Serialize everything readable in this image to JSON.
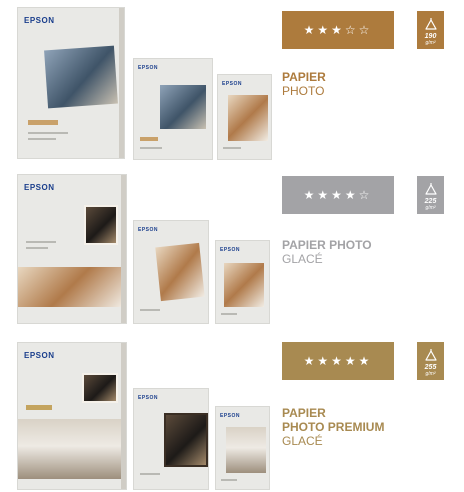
{
  "colors": {
    "bronze": "#ad7b3d",
    "silver": "#a3a3a6",
    "gold": "#a88a51"
  },
  "products": [
    {
      "brand": "EPSON",
      "stars": "★★★☆☆",
      "rating": 3,
      "rating_max": 5,
      "weight": "190",
      "weight_unit": "g/m²",
      "title_lines": [
        "PAPIER"
      ],
      "subtitle": "PHOTO"
    },
    {
      "brand": "EPSON",
      "stars": "★★★★☆",
      "rating": 4,
      "rating_max": 5,
      "weight": "225",
      "weight_unit": "g/m²",
      "title_lines": [
        "PAPIER PHOTO"
      ],
      "subtitle": "GLACÉ"
    },
    {
      "brand": "EPSON",
      "stars": "★★★★★",
      "rating": 5,
      "rating_max": 5,
      "weight": "255",
      "weight_unit": "g/m²",
      "title_lines": [
        "PAPIER",
        "PHOTO PREMIUM"
      ],
      "subtitle": "GLACÉ"
    }
  ]
}
